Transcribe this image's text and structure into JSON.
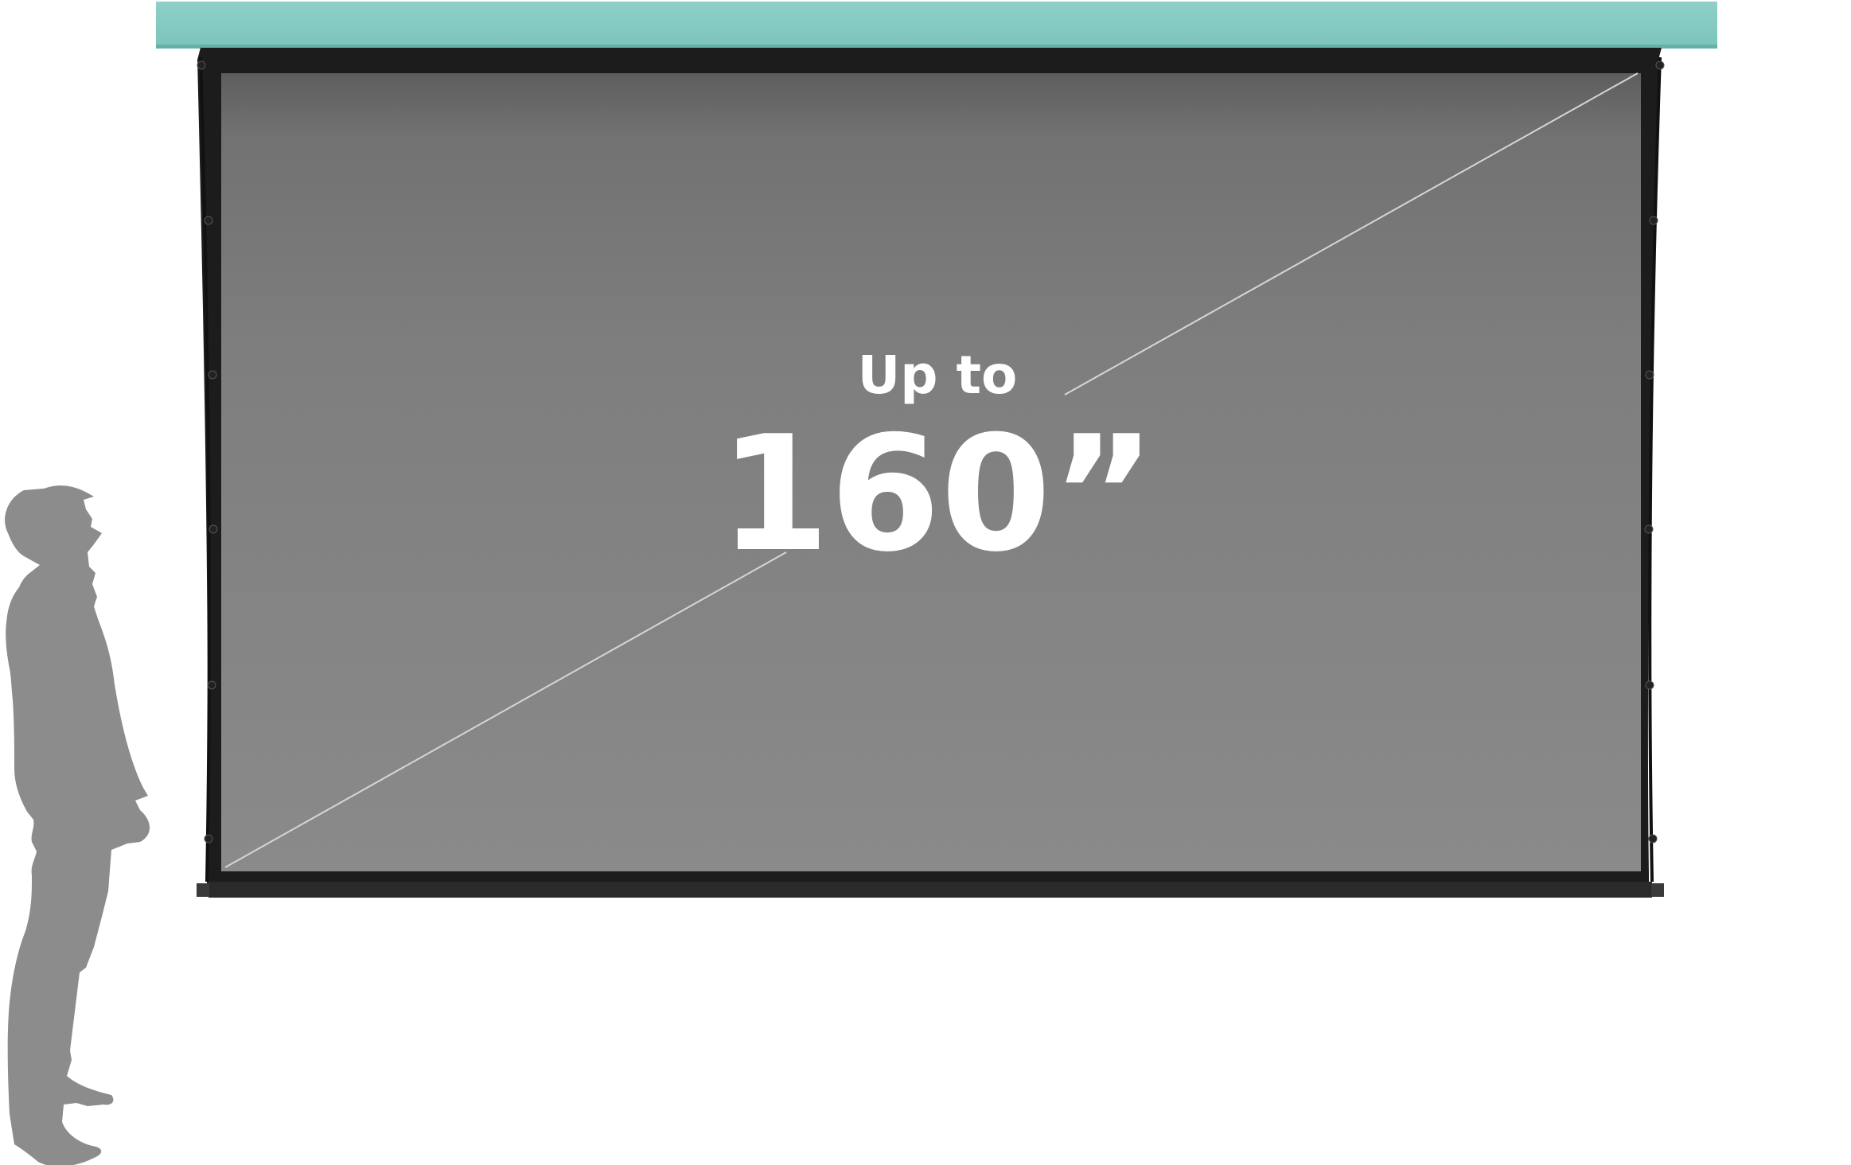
{
  "headline": {
    "prefix": "Up to",
    "size": "160”"
  },
  "colors": {
    "ceiling": "#86cbc3",
    "ceiling_edge": "#5fb3a9",
    "screen_top": "#5f5f5f",
    "screen_bottom": "#8a8a8a",
    "frame": "#1b1b1b",
    "diagonal": "#d8d8d8",
    "text": "#ffffff",
    "silhouette": "#8c8c8c"
  }
}
